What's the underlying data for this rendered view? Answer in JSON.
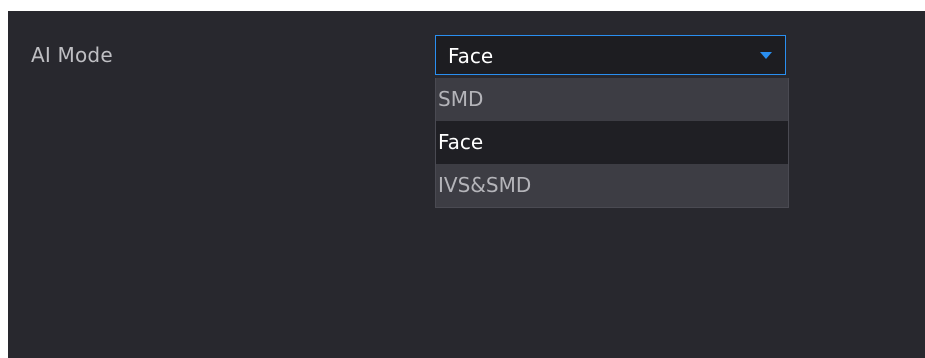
{
  "field": {
    "label": "AI Mode",
    "selected_value": "Face"
  },
  "dropdown": {
    "options": [
      {
        "label": "SMD"
      },
      {
        "label": "Face"
      },
      {
        "label": "IVS&SMD"
      }
    ]
  },
  "colors": {
    "panel_background": "#28282e",
    "accent": "#2a8ff0",
    "text_primary": "#ffffff",
    "text_muted": "#b4b4b9"
  },
  "icons": {
    "dropdown_arrow": "chevron-down-icon"
  }
}
